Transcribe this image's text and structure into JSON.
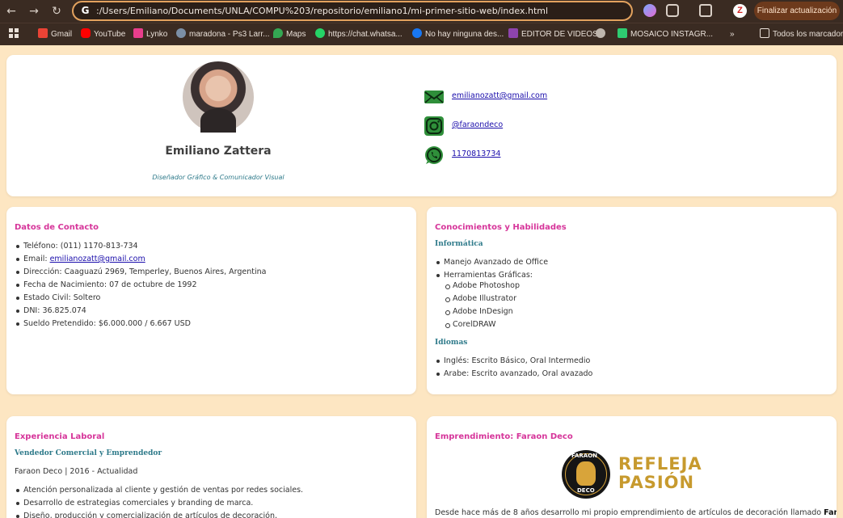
{
  "browser": {
    "url": ":/Users/Emiliano/Documents/UNLA/COMPU%203/repositorio/emiliano1/mi-primer-sitio-web/index.html",
    "update_label": "Finalizar actualización",
    "profile_initial": "Z",
    "bookmarks": [
      "Gmail",
      "YouTube",
      "Lynko",
      "maradona - Ps3 Larr...",
      "Maps",
      "https://chat.whatsa...",
      "No hay ninguna des...",
      "EDITOR DE VIDEOS",
      "MOSAICO INSTAGR...",
      "Todos los marcadores"
    ]
  },
  "profile": {
    "name": "Emiliano Zattera",
    "role": "Diseñador Gráfico & Comunicador Visual",
    "email": "emilianozatt@gmail.com",
    "instagram": "@faraondeco",
    "phone": "1170813734"
  },
  "contact_section": {
    "title": "Datos de Contacto",
    "items": [
      {
        "label": "Teléfono: ",
        "value": "(011) 1170-813-734"
      },
      {
        "label": "Email: ",
        "value": "emilianozatt@gmail.com"
      },
      {
        "label": "Dirección: ",
        "value": "Caaguazú 2969, Temperley, Buenos Aires, Argentina"
      },
      {
        "label": "Fecha de Nacimiento: ",
        "value": "07 de octubre de 1992"
      },
      {
        "label": "Estado Civil: ",
        "value": "Soltero"
      },
      {
        "label": "DNI: ",
        "value": "36.825.074"
      },
      {
        "label": "Sueldo Pretendido: ",
        "value": "$6.000.000 / 6.667 USD"
      }
    ]
  },
  "skills_section": {
    "title": "Conocimientos y Habilidades",
    "informatica_title": "Informática",
    "informatica_items": [
      "Manejo Avanzado de Office",
      "Herramientas Gráficas:"
    ],
    "graphic_tools": [
      "Adobe Photoshop",
      "Adobe Illustrator",
      "Adobe InDesign",
      "CorelDRAW"
    ],
    "idiomas_title": "Idiomas",
    "idiomas_items": [
      "Inglés: Escrito Básico, Oral Intermedio",
      "Arabe: Escrito avanzado, Oral avazado"
    ]
  },
  "experience_section": {
    "title": "Experiencia Laboral",
    "job_title": "Vendedor Comercial y Emprendedor",
    "job_meta": "Faraon Deco | 2016 - Actualidad",
    "items": [
      "Atención personalizada al cliente y gestión de ventas por redes sociales.",
      "Desarrollo de estrategias comerciales y branding de marca.",
      "Diseño, producción y comercialización de artículos de decoración."
    ]
  },
  "venture_section": {
    "title": "Emprendimiento: Faraon Deco",
    "logo_top": "FARAON",
    "logo_bottom": "DECO",
    "slogan_line1": "REFLEJA",
    "slogan_line2": "PASIÓN",
    "description_start": "Desde hace más de 8 años desarrollo mi propio emprendimiento de artículos de decoración llamado ",
    "description_brand": "Faraon"
  }
}
